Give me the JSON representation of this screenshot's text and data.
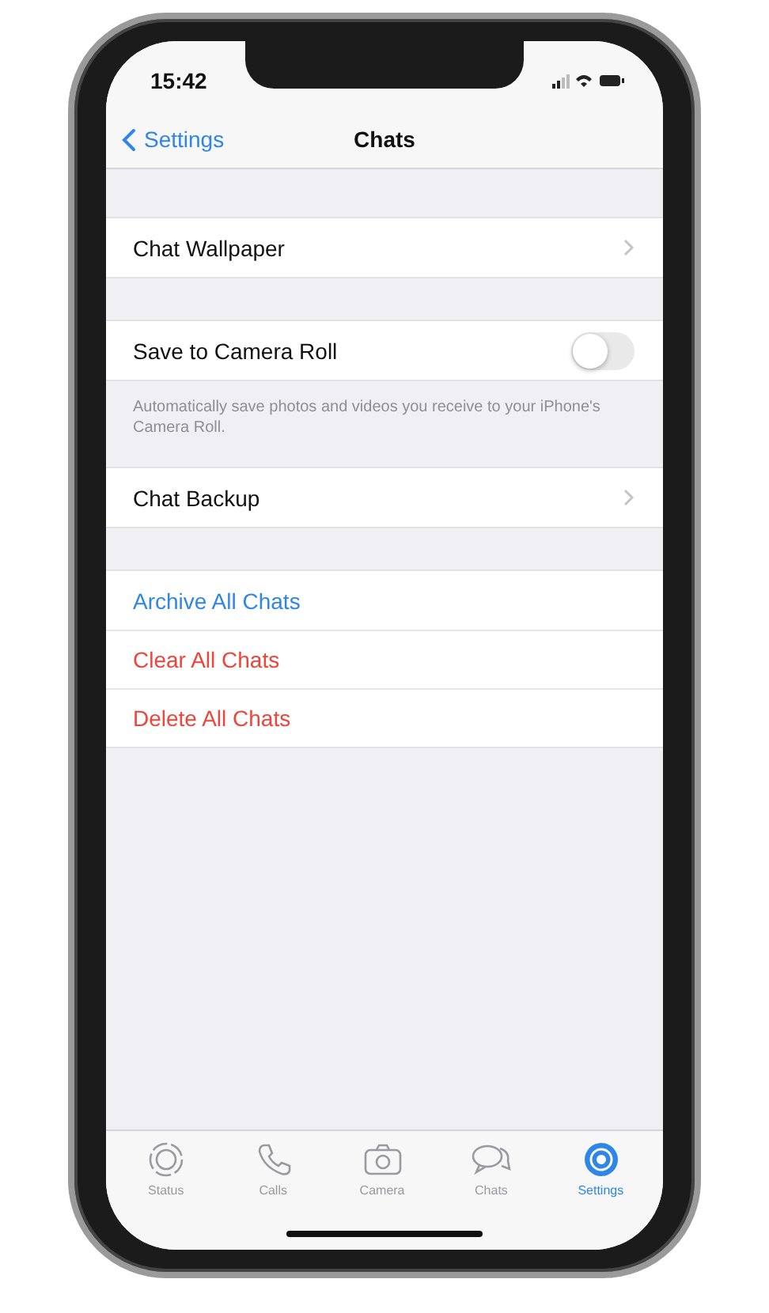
{
  "status_bar": {
    "time": "15:42"
  },
  "nav": {
    "back_label": "Settings",
    "title": "Chats"
  },
  "sections": [
    {
      "rows": [
        {
          "kind": "disclosure",
          "label": "Chat Wallpaper"
        }
      ]
    },
    {
      "rows": [
        {
          "kind": "toggle",
          "label": "Save to Camera Roll",
          "on": false
        }
      ],
      "footer": "Automatically save photos and videos you receive to your iPhone's Camera Roll."
    },
    {
      "rows": [
        {
          "kind": "disclosure",
          "label": "Chat Backup"
        }
      ]
    },
    {
      "rows": [
        {
          "kind": "action",
          "label": "Archive All Chats",
          "color": "#2f86e6"
        },
        {
          "kind": "action",
          "label": "Clear All Chats",
          "color": "#f0443a"
        },
        {
          "kind": "action",
          "label": "Delete All Chats",
          "color": "#f0443a"
        }
      ]
    }
  ],
  "tab_bar": [
    {
      "kind": "status",
      "label": "Status",
      "selected": false
    },
    {
      "kind": "calls",
      "label": "Calls",
      "selected": false
    },
    {
      "kind": "camera",
      "label": "Camera",
      "selected": false
    },
    {
      "kind": "chats",
      "label": "Chats",
      "selected": false
    },
    {
      "kind": "settings",
      "label": "Settings",
      "selected": true
    }
  ]
}
